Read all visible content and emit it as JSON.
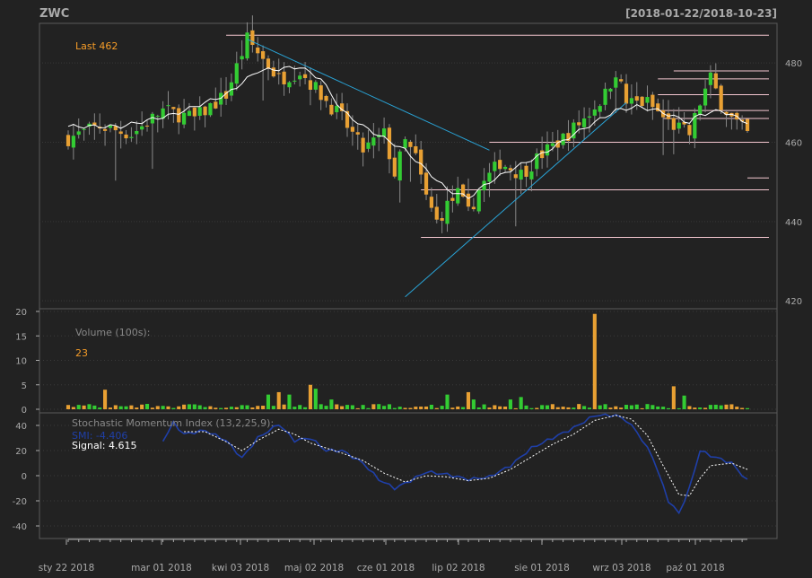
{
  "header": {
    "symbol": "ZWC",
    "date_range": "[2018-01-22/2018-10-23]"
  },
  "colors": {
    "background": "#222222",
    "panel_border": "#5a5a5a",
    "grid": "#3a3a3a",
    "up": "#33cc33",
    "down": "#e8a033",
    "wick": "#888888",
    "ma_line": "#ffffff",
    "trend_line": "#29a3d6",
    "level_line": "#f4c7d0",
    "axis_text": "#aaaaaa",
    "label_orange": "#f59c28",
    "smi_line": "#1f3fa8",
    "signal_line": "#ffffff"
  },
  "chart_data": [
    {
      "type": "candlestick",
      "panel": "price",
      "last_label": "Last 462",
      "ylim": [
        418,
        490
      ],
      "yticks": [
        "420",
        "440",
        "460",
        "480"
      ],
      "x_tick_labels": [
        "sty 22 2018",
        "mar 01 2018",
        "kwi 03 2018",
        "maj 02 2018",
        "cze 01 2018",
        "lip 02 2018",
        "sie 01 2018",
        "wrz 03 2018",
        "paź 01 2018"
      ],
      "n_bars": 130,
      "price_keypoints": [
        [
          0,
          461
        ],
        [
          6,
          464
        ],
        [
          12,
          462
        ],
        [
          18,
          468
        ],
        [
          24,
          466
        ],
        [
          30,
          472
        ],
        [
          34,
          486
        ],
        [
          40,
          476
        ],
        [
          44,
          478
        ],
        [
          48,
          472
        ],
        [
          52,
          466
        ],
        [
          56,
          458
        ],
        [
          60,
          462
        ],
        [
          62,
          452
        ],
        [
          64,
          460
        ],
        [
          66,
          456
        ],
        [
          68,
          446
        ],
        [
          70,
          440
        ],
        [
          72,
          444
        ],
        [
          74,
          447
        ],
        [
          76,
          442
        ],
        [
          78,
          448
        ],
        [
          82,
          455
        ],
        [
          86,
          452
        ],
        [
          90,
          457
        ],
        [
          94,
          461
        ],
        [
          98,
          466
        ],
        [
          102,
          472
        ],
        [
          104,
          478
        ],
        [
          106,
          470
        ],
        [
          110,
          470
        ],
        [
          114,
          465
        ],
        [
          118,
          462
        ],
        [
          120,
          470
        ],
        [
          122,
          476
        ],
        [
          124,
          470
        ],
        [
          126,
          466
        ],
        [
          129,
          462
        ]
      ],
      "moving_average_keypoints": [
        [
          0,
          464
        ],
        [
          10,
          464
        ],
        [
          20,
          467
        ],
        [
          30,
          472
        ],
        [
          36,
          478
        ],
        [
          44,
          479
        ],
        [
          48,
          476
        ],
        [
          52,
          468
        ],
        [
          56,
          464
        ],
        [
          60,
          461
        ],
        [
          64,
          458
        ],
        [
          68,
          453
        ],
        [
          72,
          448
        ],
        [
          76,
          446
        ],
        [
          80,
          450
        ],
        [
          84,
          453
        ],
        [
          90,
          457
        ],
        [
          96,
          462
        ],
        [
          100,
          465
        ],
        [
          104,
          468
        ],
        [
          108,
          469
        ],
        [
          112,
          468
        ],
        [
          116,
          466
        ],
        [
          118,
          465
        ],
        [
          120,
          467
        ],
        [
          124,
          468
        ],
        [
          129,
          465
        ]
      ],
      "trend_lines": [
        [
          [
            34,
            486
          ],
          [
            80,
            458
          ]
        ],
        [
          [
            64,
            421
          ],
          [
            106,
            470
          ]
        ]
      ],
      "horizontal_levels": [
        [
          30,
          487
        ],
        [
          115,
          478
        ],
        [
          112,
          476
        ],
        [
          112,
          472
        ],
        [
          112,
          468
        ],
        [
          113,
          466
        ],
        [
          80,
          460
        ],
        [
          129,
          451
        ],
        [
          67,
          448
        ],
        [
          67,
          436
        ]
      ]
    },
    {
      "type": "bar",
      "panel": "volume",
      "label": "Volume (100s):",
      "last_value": "23",
      "ylim": [
        0,
        20
      ],
      "yticks": [
        "0",
        "5",
        "10",
        "15",
        "20"
      ],
      "spikes": [
        [
          7,
          4
        ],
        [
          38,
          3
        ],
        [
          40,
          3.5
        ],
        [
          42,
          3
        ],
        [
          46,
          5
        ],
        [
          47,
          4.2
        ],
        [
          50,
          2
        ],
        [
          72,
          3
        ],
        [
          76,
          3.5
        ],
        [
          77,
          2
        ],
        [
          84,
          2
        ],
        [
          86,
          2.5
        ],
        [
          100,
          19.5
        ],
        [
          115,
          4.7
        ],
        [
          117,
          2.8
        ]
      ]
    },
    {
      "type": "line",
      "panel": "smi",
      "label": "Stochastic Momentum Index (13,2,25,9):",
      "smi_label": "SMI: -4.406",
      "signal_label": "Signal: 4.615",
      "ylim": [
        -50,
        50
      ],
      "yticks": [
        "40",
        "20",
        "0",
        "-20",
        "-40"
      ],
      "smi_keypoints": [
        [
          18,
          28
        ],
        [
          20,
          42
        ],
        [
          22,
          33
        ],
        [
          26,
          36
        ],
        [
          30,
          28
        ],
        [
          33,
          14
        ],
        [
          36,
          30
        ],
        [
          40,
          41
        ],
        [
          43,
          28
        ],
        [
          46,
          30
        ],
        [
          49,
          20
        ],
        [
          52,
          20
        ],
        [
          56,
          10
        ],
        [
          59,
          -3
        ],
        [
          62,
          -10
        ],
        [
          65,
          -4
        ],
        [
          68,
          3
        ],
        [
          72,
          1
        ],
        [
          76,
          -3
        ],
        [
          80,
          -1
        ],
        [
          84,
          8
        ],
        [
          88,
          22
        ],
        [
          92,
          30
        ],
        [
          96,
          38
        ],
        [
          100,
          48
        ],
        [
          104,
          48
        ],
        [
          106,
          44
        ],
        [
          108,
          35
        ],
        [
          111,
          15
        ],
        [
          114,
          -20
        ],
        [
          116,
          -30
        ],
        [
          118,
          -10
        ],
        [
          120,
          20
        ],
        [
          122,
          16
        ],
        [
          126,
          10
        ],
        [
          129,
          -4
        ]
      ],
      "signal_keypoints": [
        [
          22,
          35
        ],
        [
          26,
          35
        ],
        [
          30,
          27
        ],
        [
          33,
          20
        ],
        [
          36,
          28
        ],
        [
          40,
          37
        ],
        [
          43,
          33
        ],
        [
          46,
          26
        ],
        [
          49,
          22
        ],
        [
          52,
          18
        ],
        [
          56,
          12
        ],
        [
          60,
          2
        ],
        [
          64,
          -5
        ],
        [
          68,
          0
        ],
        [
          72,
          -1
        ],
        [
          76,
          -4
        ],
        [
          80,
          -2
        ],
        [
          84,
          5
        ],
        [
          88,
          15
        ],
        [
          92,
          25
        ],
        [
          96,
          33
        ],
        [
          100,
          44
        ],
        [
          104,
          48
        ],
        [
          107,
          45
        ],
        [
          110,
          32
        ],
        [
          113,
          8
        ],
        [
          116,
          -15
        ],
        [
          118,
          -16
        ],
        [
          120,
          -2
        ],
        [
          122,
          8
        ],
        [
          126,
          10
        ],
        [
          129,
          5
        ]
      ]
    }
  ]
}
